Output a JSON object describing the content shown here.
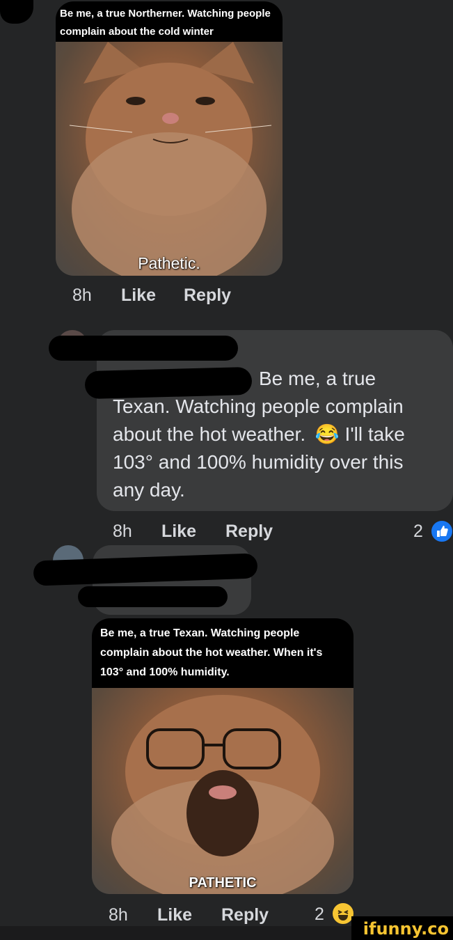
{
  "comment1": {
    "meme_caption": "Be me, a true Northerner. Watching people complain about the cold winter",
    "meme_subtitle": "Pathetic.",
    "time": "8h",
    "like": "Like",
    "reply": "Reply"
  },
  "comment2": {
    "text_line1": "Be me, a true",
    "text_rest": "Texan. Watching people complain about the hot weather.",
    "emoji": "😂",
    "text_after_emoji": " I'll take 103° and 100% humidity over this any day.",
    "time": "8h",
    "like": "Like",
    "reply": "Reply",
    "reaction_count": "2",
    "reaction_icon": "thumbs-up-icon"
  },
  "comment3": {
    "meme_caption": "Be me, a true Texan. Watching people complain about the hot weather. When it's 103° and 100% humidity.",
    "meme_subtitle": "PATHETIC",
    "time": "8h",
    "like": "Like",
    "reply": "Reply",
    "reaction_count": "2",
    "reaction_icon": "laughing-emoji-icon"
  },
  "watermark": {
    "text": "ifunny.co",
    "color": "#f6c431"
  },
  "colors": {
    "background": "#242526",
    "bubble": "#3a3b3c",
    "like_blue": "#1877f2"
  }
}
